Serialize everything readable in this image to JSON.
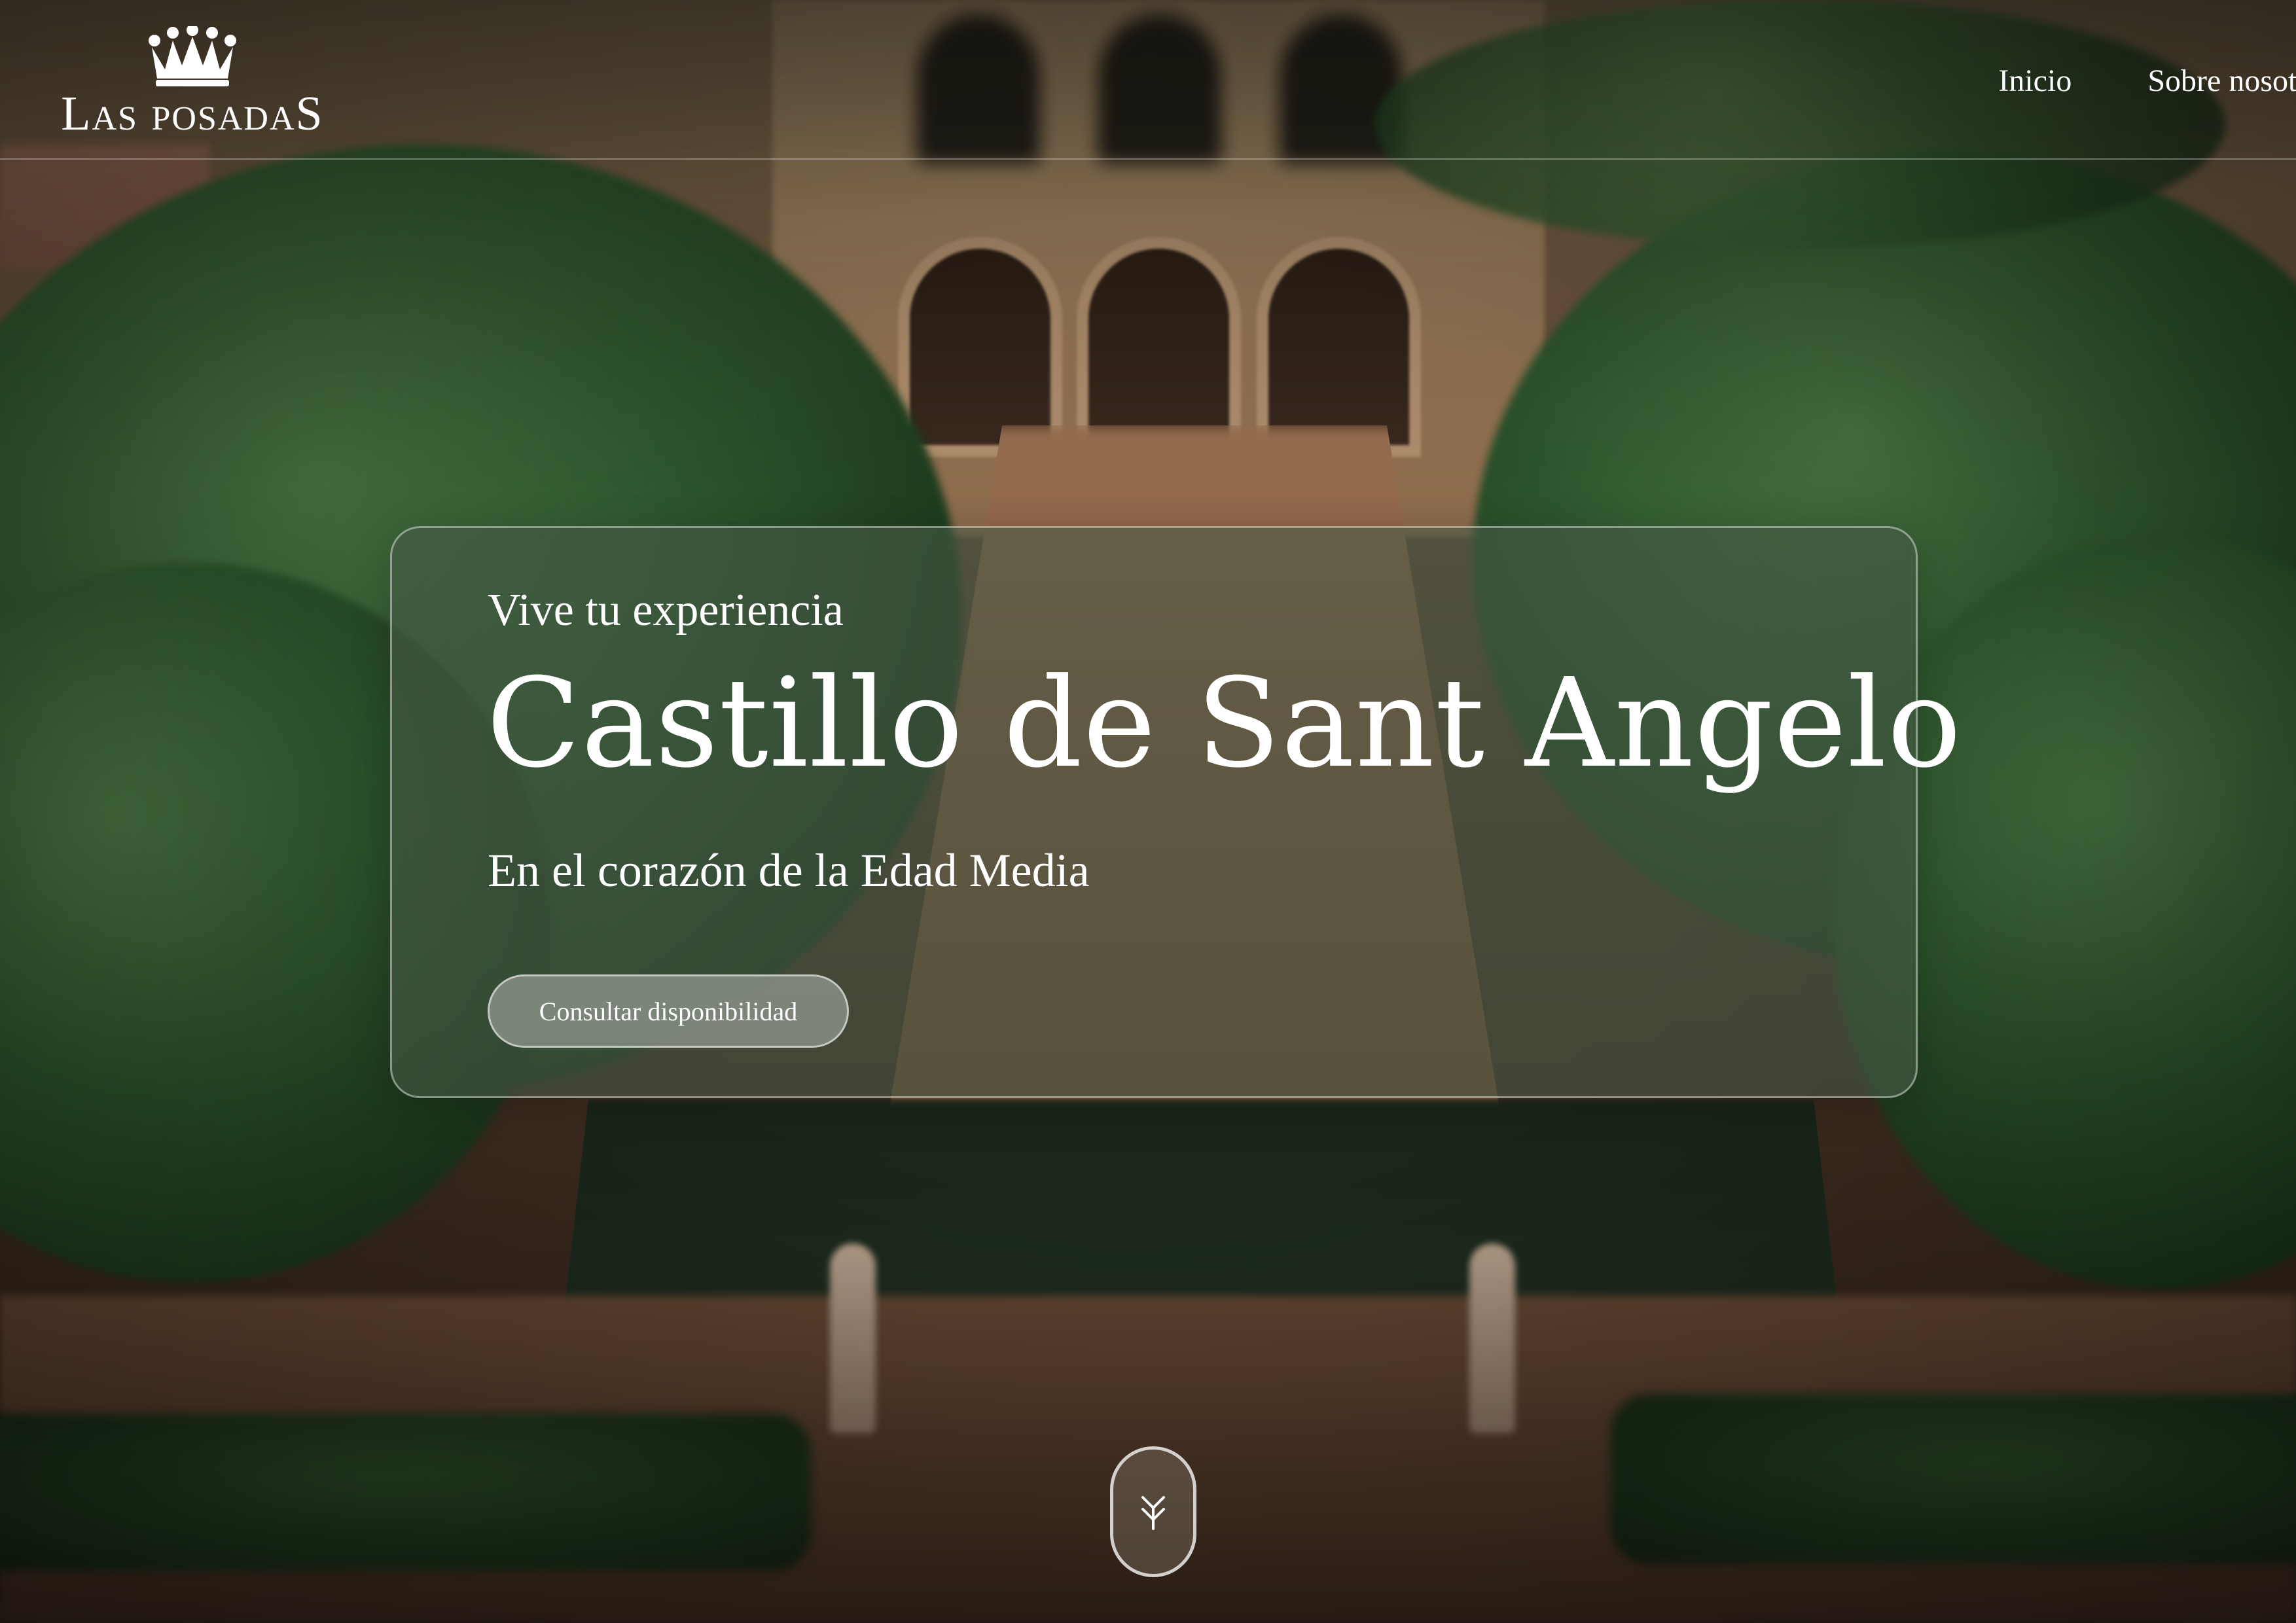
{
  "brand": {
    "name": "Las posadaS",
    "logo_icon": "crown-icon"
  },
  "nav": {
    "items": [
      {
        "label": "Inicio"
      },
      {
        "label": "Sobre nosotros"
      }
    ]
  },
  "hero": {
    "eyebrow": "Vive tu experiencia",
    "title": "Castillo de Sant Angelo",
    "subtitle": "En el corazón de la Edad Media",
    "cta_label": "Consultar disponibilidad"
  },
  "scroll": {
    "icon": "chevrons-down-icon"
  },
  "colors": {
    "text": "#ffffff",
    "card_tint": "#465a46",
    "button_tint": "#969c92"
  }
}
